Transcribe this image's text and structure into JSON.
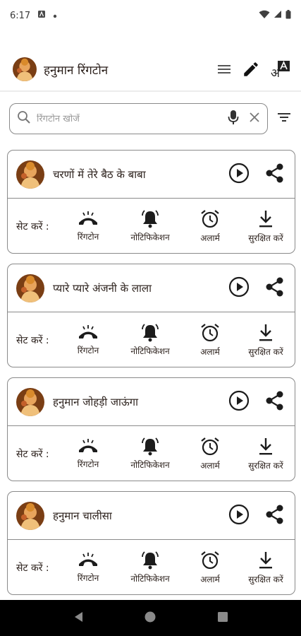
{
  "status_bar": {
    "time": "6:17"
  },
  "app_bar": {
    "title": "हनुमान रिंगटोन",
    "icons": [
      "menu-icon",
      "edit-icon",
      "translate-icon"
    ]
  },
  "search": {
    "placeholder": "रिंगटोन खोजें",
    "value": ""
  },
  "set_label": "सेट करें :",
  "actions": {
    "ringtone": "रिंगटोन",
    "notification": "नोटिफिकेशन",
    "alarm": "अलार्म",
    "save": "सुरक्षित करें"
  },
  "ringtones": [
    {
      "title": "चरणों में तेरे बैठ के बाबा"
    },
    {
      "title": "प्यारे प्यारे अंजनी के लाला"
    },
    {
      "title": "हनुमान जोहड़ी जाऊंगा"
    },
    {
      "title": "हनुमान चालीसा"
    }
  ],
  "colors": {
    "icon": "#2a1f1a",
    "border": "#8a8a8a",
    "nav": "#000000"
  }
}
